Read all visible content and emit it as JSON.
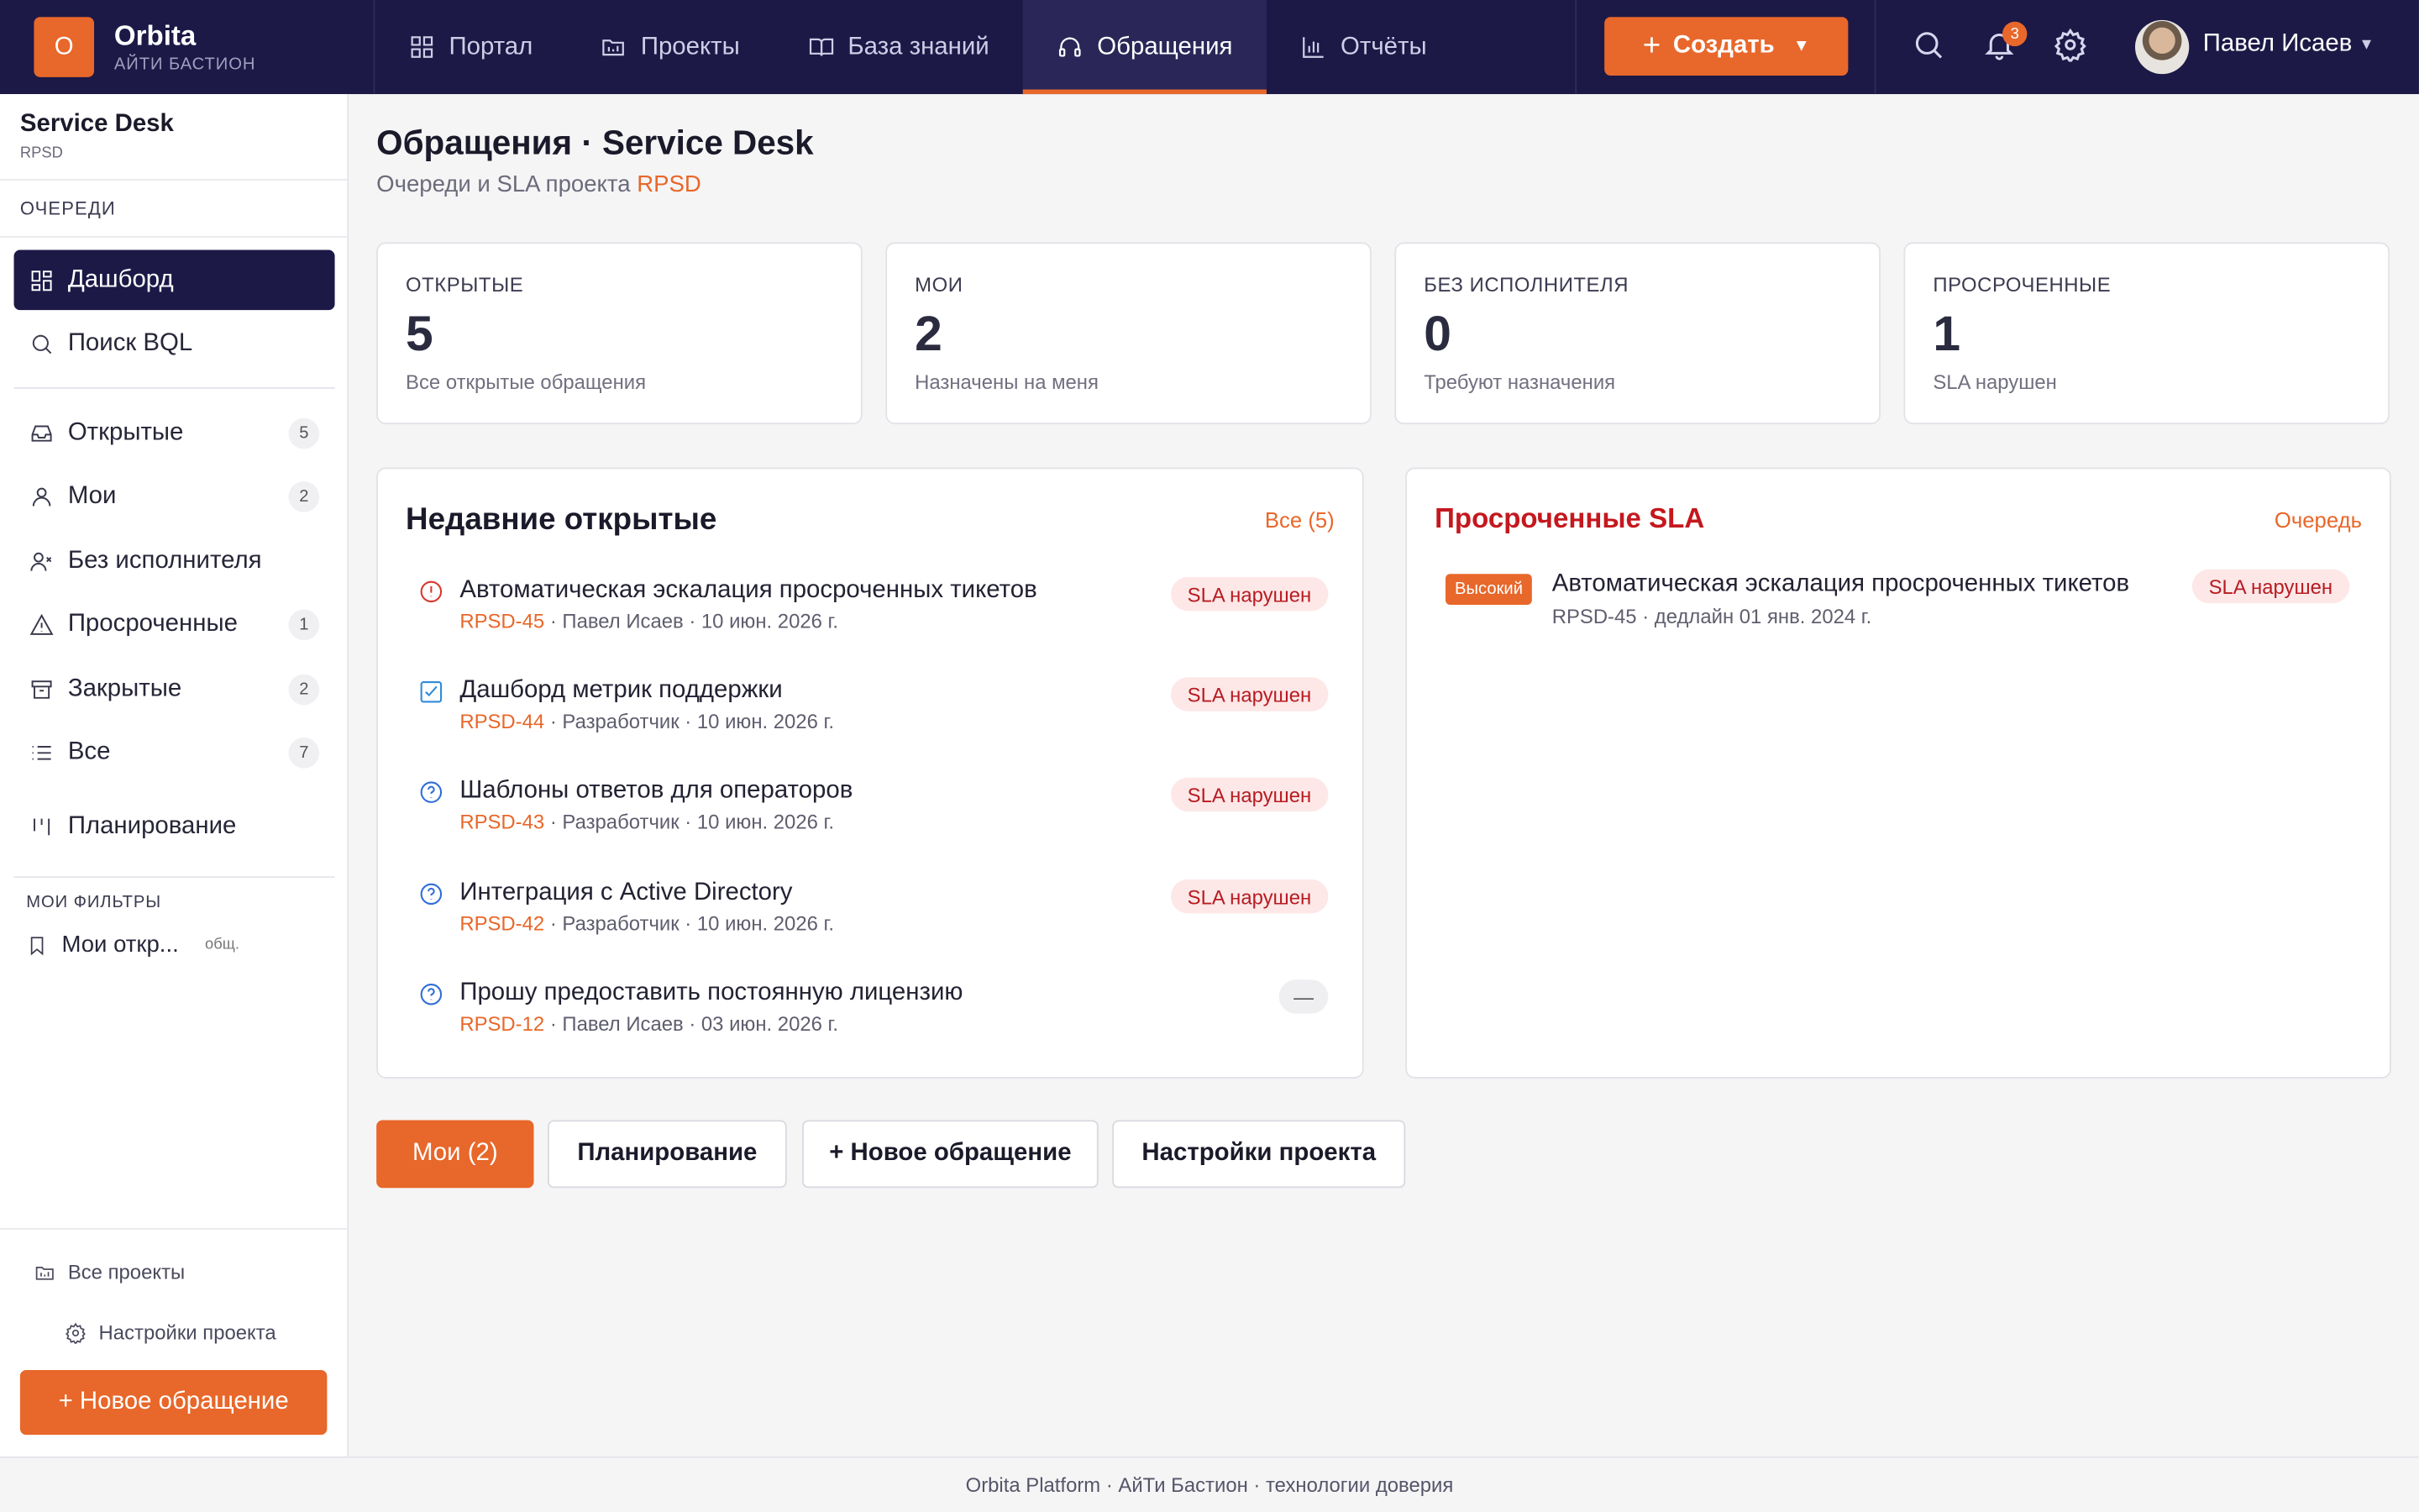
{
  "brand": {
    "logo_letter": "O",
    "name": "Orbita",
    "subtitle": "АЙТИ БАСТИОН"
  },
  "nav": {
    "items": [
      {
        "label": "Портал",
        "icon": "grid-icon",
        "active": false
      },
      {
        "label": "Проекты",
        "icon": "folder-icon",
        "active": false
      },
      {
        "label": "База знаний",
        "icon": "book-icon",
        "active": false
      },
      {
        "label": "Обращения",
        "icon": "headset-icon",
        "active": true
      },
      {
        "label": "Отчёты",
        "icon": "bar-chart-icon",
        "active": false
      }
    ]
  },
  "header": {
    "create_label": "Создать",
    "notifications_count": "3",
    "user_name": "Павел Исаев"
  },
  "sidebar": {
    "project_name": "Service Desk",
    "project_key": "RPSD",
    "section_queues": "ОЧЕРЕДИ",
    "items": [
      {
        "label": "Дашборд",
        "icon": "dashboard-icon",
        "active": true
      },
      {
        "label": "Поиск BQL",
        "icon": "search-icon"
      },
      {
        "label": "Открытые",
        "icon": "inbox-icon",
        "count": "5"
      },
      {
        "label": "Мои",
        "icon": "user-icon",
        "count": "2"
      },
      {
        "label": "Без исполнителя",
        "icon": "user-x-icon"
      },
      {
        "label": "Просроченные",
        "icon": "alert-triangle-icon",
        "count": "1"
      },
      {
        "label": "Закрытые",
        "icon": "archive-icon",
        "count": "2"
      },
      {
        "label": "Все",
        "icon": "list-icon",
        "count": "7"
      },
      {
        "label": "Планирование",
        "icon": "planning-icon"
      }
    ],
    "filters_title": "МОИ ФИЛЬТРЫ",
    "filter": {
      "label": "Мои откр...",
      "tag": "общ."
    },
    "all_projects": "Все проекты",
    "project_settings": "Настройки проекта",
    "new_request": "+ Новое обращение"
  },
  "page": {
    "title": "Обращения · Service Desk",
    "subtitle_prefix": "Очереди и SLA проекта ",
    "subtitle_key": "RPSD"
  },
  "stats": [
    {
      "label": "ОТКРЫТЫЕ",
      "value": "5",
      "desc": "Все открытые обращения"
    },
    {
      "label": "МОИ",
      "value": "2",
      "desc": "Назначены на меня"
    },
    {
      "label": "БЕЗ ИСПОЛНИТЕЛЯ",
      "value": "0",
      "desc": "Требуют назначения"
    },
    {
      "label": "ПРОСРОЧЕННЫЕ",
      "value": "1",
      "desc": "SLA нарушен"
    }
  ],
  "recent": {
    "title": "Недавние открытые",
    "link": "Все (5)",
    "tickets": [
      {
        "icon": "alert-circle-icon",
        "icon_color": "#d9382e",
        "title": "Автоматическая эскалация просроченных тикетов",
        "key": "RPSD-45",
        "meta": " · Павел Исаев · 10 июн. 2026 г.",
        "status": "SLA нарушен"
      },
      {
        "icon": "checkbox-icon",
        "icon_color": "#2e8bd9",
        "title": "Дашборд метрик поддержки",
        "key": "RPSD-44",
        "meta": " · Разработчик · 10 июн. 2026 г.",
        "status": "SLA нарушен"
      },
      {
        "icon": "question-circle-icon",
        "icon_color": "#2e6ed9",
        "title": "Шаблоны ответов для операторов",
        "key": "RPSD-43",
        "meta": " · Разработчик · 10 июн. 2026 г.",
        "status": "SLA нарушен"
      },
      {
        "icon": "question-circle-icon",
        "icon_color": "#2e6ed9",
        "title": "Интеграция с Active Directory",
        "key": "RPSD-42",
        "meta": " · Разработчик · 10 июн. 2026 г.",
        "status": "SLA нарушен"
      },
      {
        "icon": "question-circle-icon",
        "icon_color": "#2e6ed9",
        "title": "Прошу предоставить постоянную лицензию",
        "key": "RPSD-12",
        "meta": " · Павел Исаев · 03 июн. 2026 г.",
        "status": "—"
      }
    ]
  },
  "overdue": {
    "title": "Просроченные SLA",
    "link": "Очередь",
    "item": {
      "priority": "Высокий",
      "title": "Автоматическая эскалация просроченных тикетов",
      "meta": "RPSD-45 · дедлайн 01 янв. 2024 г.",
      "status": "SLA нарушен"
    }
  },
  "actions": {
    "mine": "Мои (2)",
    "planning": "Планирование",
    "new_request": "+ Новое обращение",
    "settings": "Настройки проекта"
  },
  "footer": {
    "text": "Orbita Platform · АйТи Бастион · технологии доверия"
  }
}
